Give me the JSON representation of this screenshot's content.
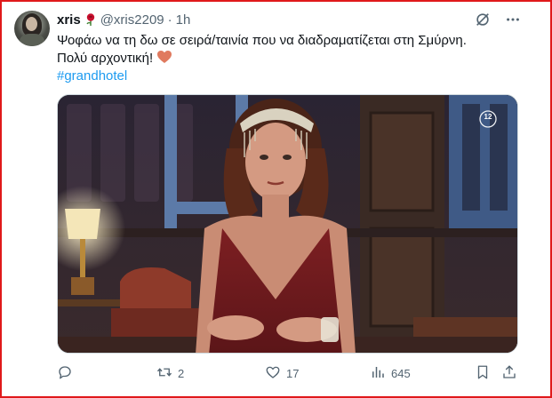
{
  "tweet": {
    "author_name": "xris",
    "handle": "@xris2209",
    "separator": "·",
    "time": "1h",
    "text_line1": "Ψοφάω να τη δω σε σειρά/ταινία που να διαδραματίζεται στη Σμύρνη.",
    "text_line2": "Πολύ αρχοντική!",
    "hashtag": "#grandhotel",
    "media_rating_badge": "12"
  },
  "actions": {
    "reply_count": "",
    "retweet_count": "2",
    "like_count": "17",
    "views_count": "645"
  },
  "icons": {
    "author_emoji": "rose-icon",
    "text_emoji": "orange-heart-icon",
    "top_right": [
      "grok-icon",
      "more-icon"
    ],
    "bottom": [
      "reply-icon",
      "retweet-icon",
      "like-icon",
      "views-icon",
      "bookmark-icon",
      "share-icon"
    ]
  },
  "colors": {
    "frame_border": "#e0191b",
    "link": "#1d9bf0",
    "muted": "#536471",
    "heart_emoji": "#e07a5f"
  }
}
